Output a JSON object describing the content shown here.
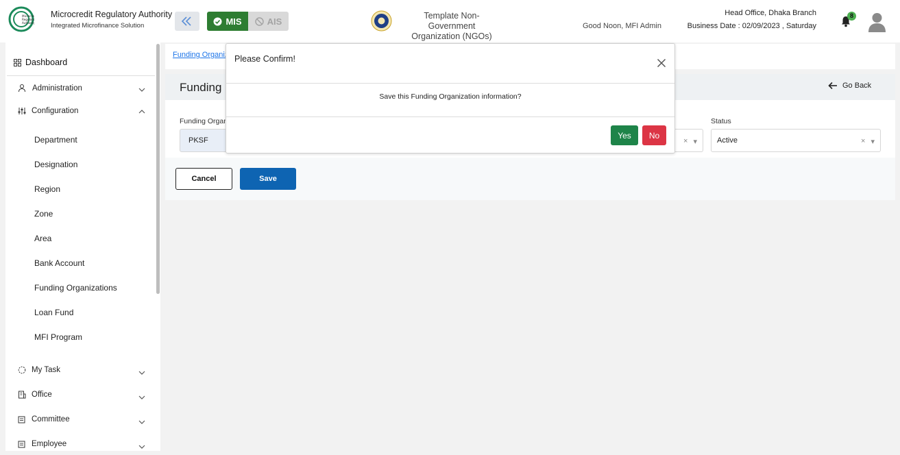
{
  "header": {
    "app_title": "Microcredit Regulatory Authority",
    "app_subtitle": "Integrated Microfinance Solution",
    "logo_text": "Microcredit Regulatory Authority",
    "mis_label": "MIS",
    "ais_label": "AIS",
    "org_name_line1": "Template Non-Government",
    "org_name_line2": "Organization (NGOs)",
    "greeting": "Good Noon, MFI Admin",
    "branch": "Head Office, Dhaka Branch",
    "business_date": "Business Date : 02/09/2023 , Saturday",
    "notification_count": "8"
  },
  "sidebar": {
    "dashboard": "Dashboard",
    "administration": "Administration",
    "configuration": "Configuration",
    "config_items": [
      "Department",
      "Designation",
      "Region",
      "Zone",
      "Area",
      "Bank Account",
      "Funding Organizations",
      "Loan Fund",
      "MFI Program"
    ],
    "my_task": "My Task",
    "office": "Office",
    "committee": "Committee",
    "employee": "Employee"
  },
  "main": {
    "breadcrumb": "Funding Organiz",
    "page_title": "Funding",
    "go_back": "Go Back",
    "funding_org_label": "Funding Organ",
    "funding_org_value": "PKSF",
    "status_label": "Status",
    "status_value": "Active",
    "cancel_label": "Cancel",
    "save_label": "Save"
  },
  "modal": {
    "title": "Please Confirm!",
    "message": "Save this Funding Organization information?",
    "yes_label": "Yes",
    "no_label": "No"
  },
  "colors": {
    "mis_green": "#2e7d32",
    "save_blue": "#0e64b2",
    "yes_green": "#1e8449",
    "no_red": "#dc3545"
  }
}
